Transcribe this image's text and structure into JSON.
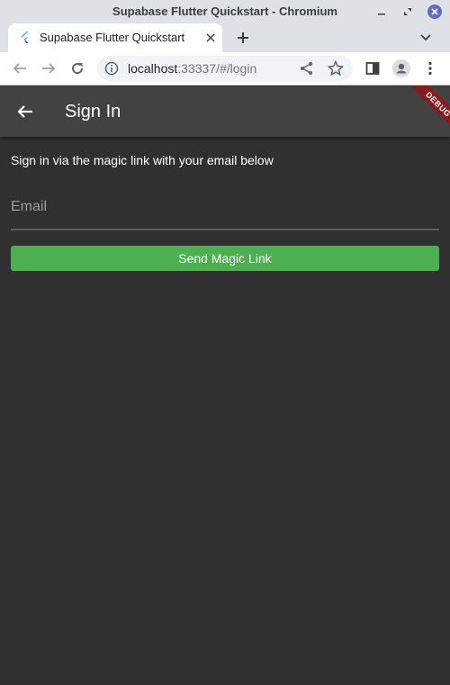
{
  "window": {
    "title": "Supabase Flutter Quickstart - Chromium"
  },
  "tab": {
    "title": "Supabase Flutter Quickstart",
    "favicon": "flutter-icon"
  },
  "toolbar": {
    "url_host": "localhost",
    "url_rest": ":33337/#/login"
  },
  "app": {
    "title": "Sign In",
    "debug_label": "DEBUG",
    "description": "Sign in via the magic link with your email below",
    "email_placeholder": "Email",
    "email_value": "",
    "send_button_label": "Send Magic Link"
  },
  "colors": {
    "background": "#303030",
    "appbar": "#424242",
    "button": "#4caf50",
    "debug_ribbon": "#8b1a1a"
  }
}
